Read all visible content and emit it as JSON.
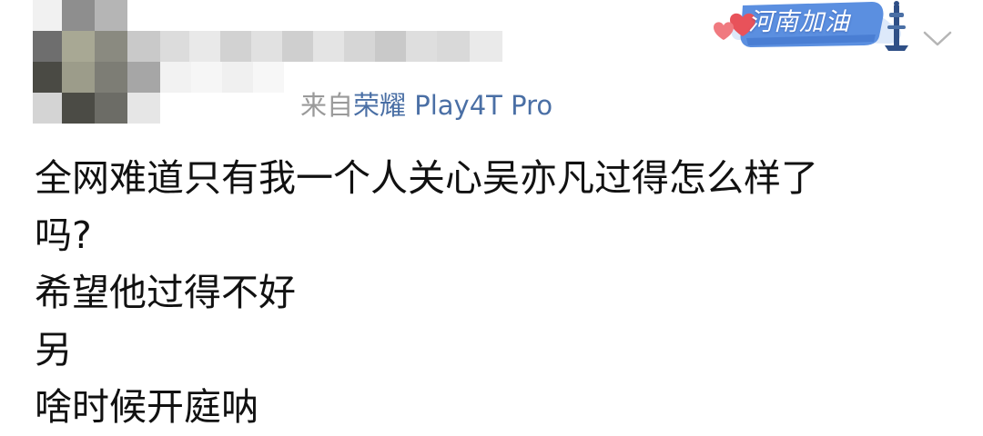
{
  "post": {
    "source_prefix": "来自",
    "source_device": "荣耀 Play4T Pro",
    "badge_text": "河南加油",
    "lines": [
      "全网难道只有我一个人关心吴亦凡过得怎么样了",
      "吗?",
      "希望他过得不好",
      "另",
      "啥时候开庭呐"
    ]
  },
  "icons": {
    "badge_icon": "henan-support-badge-icon",
    "menu_icon": "chevron-down-icon",
    "avatar": "pixelated-avatar"
  },
  "colors": {
    "source_prefix": "#9a9a9a",
    "source_device": "#4a6fa5",
    "body_text": "#111111",
    "badge_blue": "#5b8fe0",
    "badge_heart": "#e8525a"
  }
}
